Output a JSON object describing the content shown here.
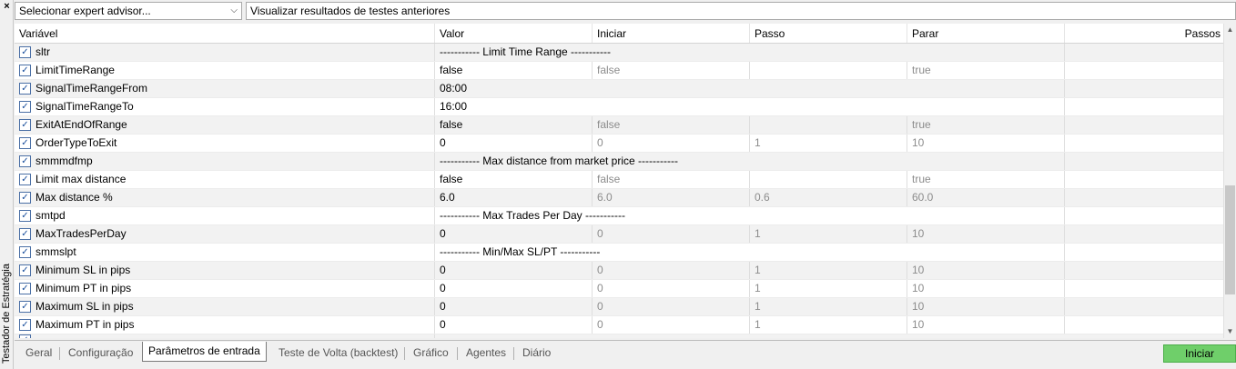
{
  "window": {
    "side_title": "Testador de Estratégia",
    "close": "×"
  },
  "top": {
    "expert_select": "Selecionar expert advisor...",
    "results_select": "Visualizar resultados de testes anteriores",
    "arrow": "⌵"
  },
  "table": {
    "headers": [
      "Variável",
      "Valor",
      "Iniciar",
      "Passo",
      "Parar",
      "Passos"
    ],
    "rows": [
      {
        "name": "sltr",
        "sep": "----------- Limit Time Range -----------"
      },
      {
        "name": "LimitTimeRange",
        "value": "false",
        "start": "false",
        "step": "",
        "stop": "true"
      },
      {
        "name": "SignalTimeRangeFrom",
        "value": "08:00"
      },
      {
        "name": "SignalTimeRangeTo",
        "value": "16:00"
      },
      {
        "name": "ExitAtEndOfRange",
        "value": "false",
        "start": "false",
        "step": "",
        "stop": "true"
      },
      {
        "name": "OrderTypeToExit",
        "value": "0",
        "start": "0",
        "step": "1",
        "stop": "10"
      },
      {
        "name": "smmmdfmp",
        "sep": "----------- Max distance from market price -----------"
      },
      {
        "name": "Limit max distance",
        "value": "false",
        "start": "false",
        "step": "",
        "stop": "true"
      },
      {
        "name": "Max distance %",
        "value": "6.0",
        "start": "6.0",
        "step": "0.6",
        "stop": "60.0"
      },
      {
        "name": "smtpd",
        "sep": "----------- Max Trades Per Day -----------"
      },
      {
        "name": "MaxTradesPerDay",
        "value": "0",
        "start": "0",
        "step": "1",
        "stop": "10"
      },
      {
        "name": "smmslpt",
        "sep": "----------- Min/Max SL/PT -----------"
      },
      {
        "name": "Minimum SL in pips",
        "value": "0",
        "start": "0",
        "step": "1",
        "stop": "10"
      },
      {
        "name": "Minimum PT in pips",
        "value": "0",
        "start": "0",
        "step": "1",
        "stop": "10"
      },
      {
        "name": "Maximum SL in pips",
        "value": "0",
        "start": "0",
        "step": "1",
        "stop": "10"
      },
      {
        "name": "Maximum PT in pips",
        "value": "0",
        "start": "0",
        "step": "1",
        "stop": "10"
      }
    ]
  },
  "tabs": [
    "Geral",
    "Configuração",
    "Parâmetros de entrada",
    "Teste de Volta (backtest)",
    "Gráfico",
    "Agentes",
    "Diário"
  ],
  "active_tab": "Parâmetros de entrada",
  "start_button": "Iniciar",
  "colors": {
    "start_button": "#6fcf6a",
    "alt_row": "#f2f2f2",
    "checkbox": "#1a4f9c"
  }
}
